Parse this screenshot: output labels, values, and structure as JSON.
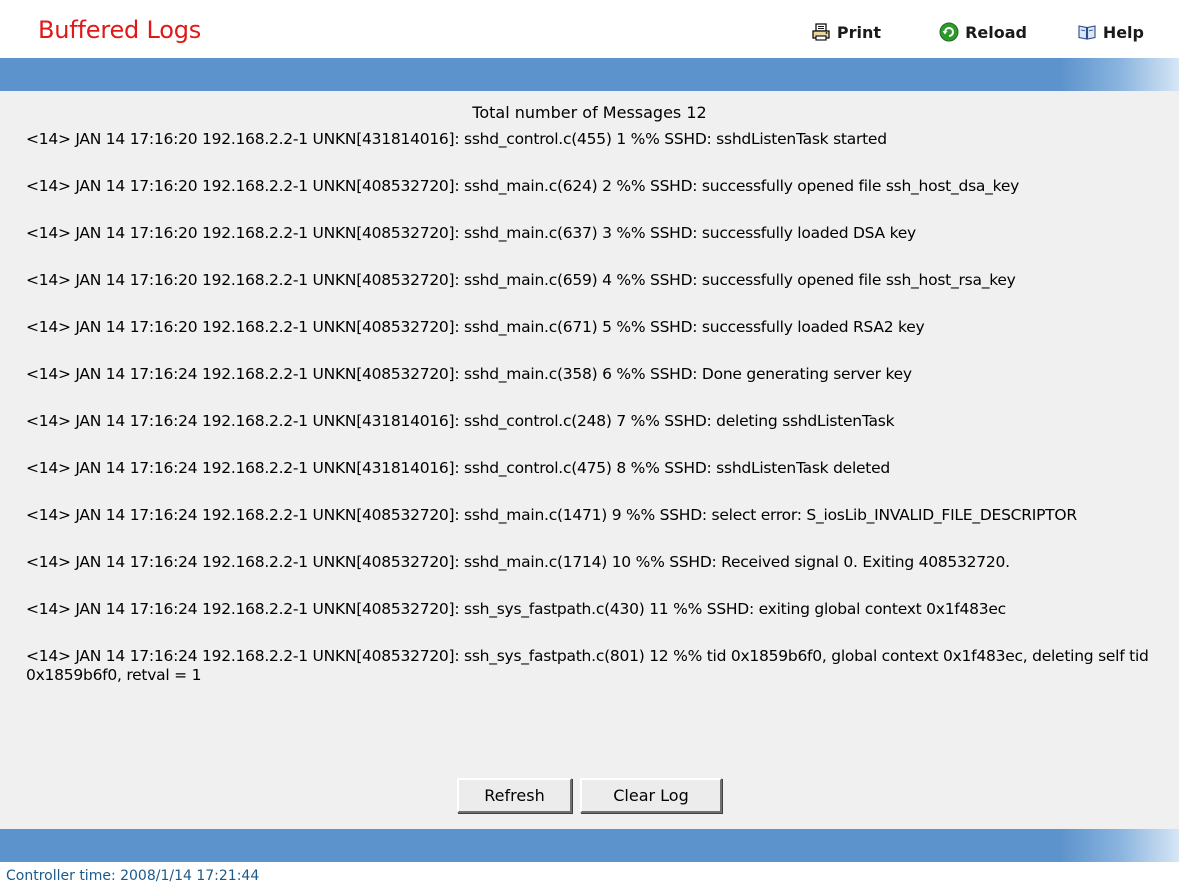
{
  "header": {
    "title": "Buffered Logs",
    "title_color": "#e01818",
    "toolbar": [
      {
        "label": "Print",
        "icon": "printer-icon"
      },
      {
        "label": "Reload",
        "icon": "reload-icon"
      },
      {
        "label": "Help",
        "icon": "help-book-icon"
      }
    ]
  },
  "bar_color": "#5d93cc",
  "content": {
    "total_label": "Total number of Messages 12",
    "logs": [
      "<14> JAN 14 17:16:20 192.168.2.2-1 UNKN[431814016]: sshd_control.c(455) 1 %% SSHD: sshdListenTask started",
      "<14> JAN 14 17:16:20 192.168.2.2-1 UNKN[408532720]: sshd_main.c(624) 2 %% SSHD: successfully opened file ssh_host_dsa_key",
      "<14> JAN 14 17:16:20 192.168.2.2-1 UNKN[408532720]: sshd_main.c(637) 3 %% SSHD: successfully loaded DSA key",
      "<14> JAN 14 17:16:20 192.168.2.2-1 UNKN[408532720]: sshd_main.c(659) 4 %% SSHD: successfully opened file ssh_host_rsa_key",
      "<14> JAN 14 17:16:20 192.168.2.2-1 UNKN[408532720]: sshd_main.c(671) 5 %% SSHD: successfully loaded RSA2 key",
      "<14> JAN 14 17:16:24 192.168.2.2-1 UNKN[408532720]: sshd_main.c(358) 6 %% SSHD: Done generating server key",
      "<14> JAN 14 17:16:24 192.168.2.2-1 UNKN[431814016]: sshd_control.c(248) 7 %% SSHD: deleting sshdListenTask",
      "<14> JAN 14 17:16:24 192.168.2.2-1 UNKN[431814016]: sshd_control.c(475) 8 %% SSHD: sshdListenTask deleted",
      "<14> JAN 14 17:16:24 192.168.2.2-1 UNKN[408532720]: sshd_main.c(1471) 9 %% SSHD: select error: S_iosLib_INVALID_FILE_DESCRIPTOR",
      "<14> JAN 14 17:16:24 192.168.2.2-1 UNKN[408532720]: sshd_main.c(1714) 10 %% SSHD: Received signal 0. Exiting 408532720.",
      "<14> JAN 14 17:16:24 192.168.2.2-1 UNKN[408532720]: ssh_sys_fastpath.c(430) 11 %% SSHD: exiting global context 0x1f483ec",
      "<14> JAN 14 17:16:24 192.168.2.2-1 UNKN[408532720]: ssh_sys_fastpath.c(801) 12 %% tid 0x1859b6f0, global context 0x1f483ec, deleting self tid 0x1859b6f0, retval = 1"
    ],
    "buttons": {
      "refresh": "Refresh",
      "clear": "Clear Log"
    }
  },
  "footer": {
    "controller_time": "Controller time: 2008/1/14 17:21:44"
  }
}
